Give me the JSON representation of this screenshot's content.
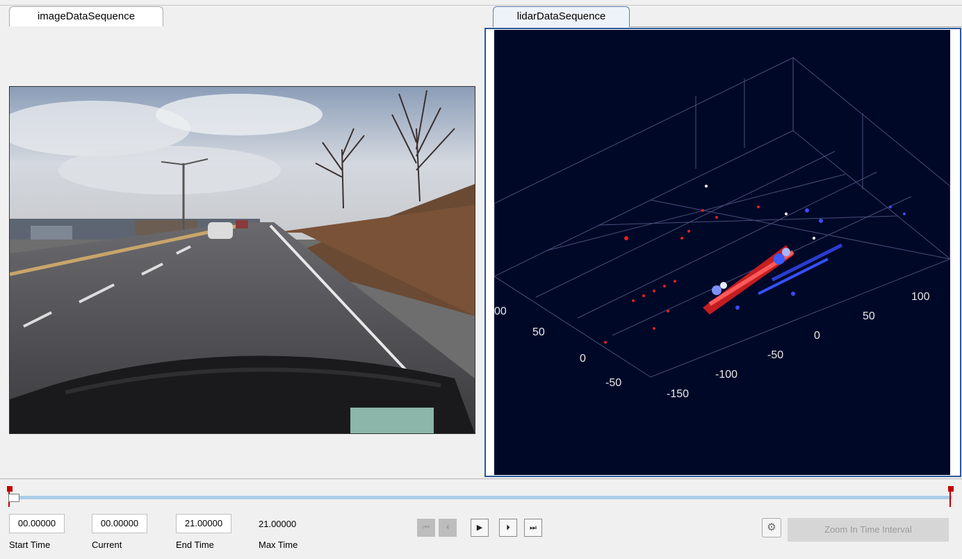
{
  "tabs": {
    "image": "imageDataSequence",
    "lidar": "lidarDataSequence"
  },
  "lidar_axes": {
    "x_ticks": [
      "-150",
      "-100",
      "-50",
      "0",
      "50",
      "100"
    ],
    "y_ticks": [
      "-50",
      "0",
      "50",
      "00"
    ]
  },
  "timeline": {
    "start_time": "00.00000",
    "start_label": "Start Time",
    "current_time": "00.00000",
    "current_label": "Current",
    "end_time": "21.00000",
    "end_label": "End Time",
    "max_time": "21.00000",
    "max_label": "Max Time",
    "current_fraction": 0
  },
  "playback": {
    "buttons": [
      {
        "icon": "skip-to-start-icon",
        "glyph": "⏮",
        "enabled": false
      },
      {
        "icon": "step-back-icon",
        "glyph": "⏴",
        "enabled": false
      },
      {
        "icon": "play-icon",
        "glyph": "▶",
        "enabled": true
      },
      {
        "icon": "step-forward-icon",
        "glyph": "⏵",
        "enabled": true
      },
      {
        "icon": "skip-to-end-icon",
        "glyph": "⏭",
        "enabled": true
      }
    ]
  },
  "zoom": {
    "settings_icon": "zoom-settings-icon",
    "button_label": "Zoom In Time Interval",
    "enabled": false
  },
  "colors": {
    "accent": "#2b5797",
    "flag": "#c00000",
    "lidar_bg": "#000828"
  }
}
